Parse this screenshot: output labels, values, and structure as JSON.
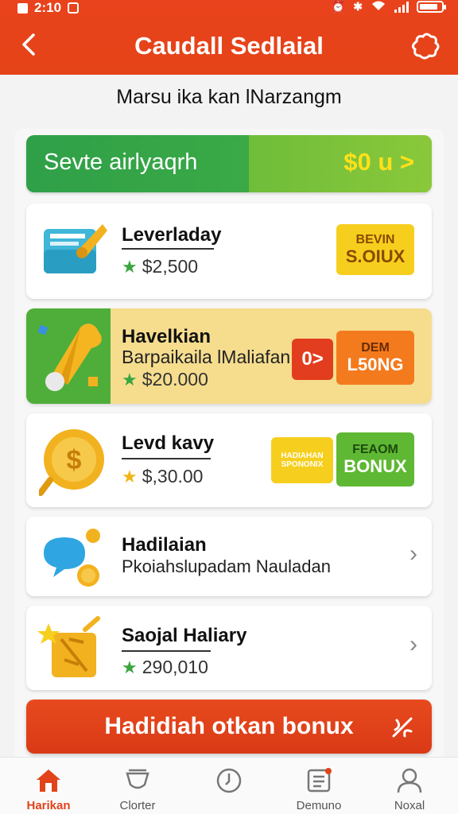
{
  "status_bar": {
    "time": "2:10"
  },
  "header": {
    "title": "Caudall Sedlaial",
    "back_icon": "chevron-left-icon",
    "action_icon": "puzzle-icon"
  },
  "subtitle": "Marsu ika kan lNarzangm",
  "balance": {
    "label": "Sevte airlyaqrh",
    "value": "$0 u >"
  },
  "cards": [
    {
      "title": "Leverladay",
      "price": "$2,500",
      "badge_line1": "BEVIN",
      "badge_line2": "S.OIUX",
      "icon": "document-icon"
    },
    {
      "title": "Havelkian",
      "sub": "Barpaikaila lMaliafan",
      "price": "$20.000",
      "small_badge": "0>",
      "badge_line1": "DEM",
      "badge_line2": "L50NG",
      "icon": "bell-icon"
    },
    {
      "title": "Levd kavy",
      "price": "$,30.00",
      "badge_a1": "HADIAHAN",
      "badge_a2": "SPONONIX",
      "badge_line1": "FEAOM",
      "badge_line2": "BONUX",
      "icon": "coin-icon"
    },
    {
      "title": "Hadilaian",
      "sub": "Pkoiahslupadam Nauladan",
      "icon": "chat-coin-icon"
    },
    {
      "title": "Saojal Haliary",
      "price": "290,010",
      "icon": "gift-icon"
    }
  ],
  "cta": {
    "label": "Hadidiah otkan bonux",
    "icon": "sparkle-icon"
  },
  "nav": [
    {
      "label": "Harikan",
      "icon": "home-icon"
    },
    {
      "label": "Clorter",
      "icon": "cup-icon"
    },
    {
      "label": "",
      "icon": "clock-icon"
    },
    {
      "label": "Demuno",
      "icon": "list-icon"
    },
    {
      "label": "Noxal",
      "icon": "user-icon"
    }
  ],
  "colors": {
    "brand": "#e54318",
    "green": "#3aa946",
    "yellow": "#f6cf1e"
  }
}
